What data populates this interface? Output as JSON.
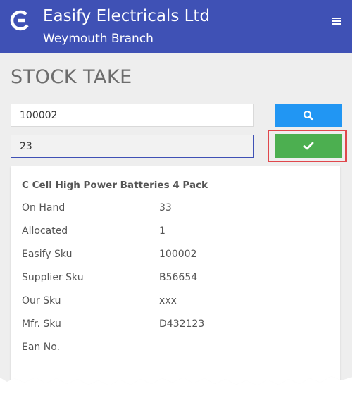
{
  "header": {
    "company": "Easify Electricals Ltd",
    "branch": "Weymouth Branch",
    "logo_icon": "easify-e-logo",
    "menu_icon": "hamburger-menu-icon",
    "background_color": "#3f51b5"
  },
  "page": {
    "title": "STOCK TAKE"
  },
  "form": {
    "sku_value": "100002",
    "quantity_value": "23",
    "search_button_icon": "search-icon",
    "search_button_color": "#2196f3",
    "confirm_button_icon": "check-icon",
    "confirm_button_color": "#4caf50",
    "highlight_color": "#e0474c"
  },
  "product": {
    "name": "C Cell High Power Batteries 4 Pack",
    "details": [
      {
        "label": "On Hand",
        "value": "33"
      },
      {
        "label": "Allocated",
        "value": "1"
      },
      {
        "label": "Easify Sku",
        "value": "100002"
      },
      {
        "label": "Supplier Sku",
        "value": "B56654"
      },
      {
        "label": "Our Sku",
        "value": "xxx"
      },
      {
        "label": "Mfr. Sku",
        "value": "D432123"
      },
      {
        "label": "Ean No.",
        "value": ""
      }
    ]
  }
}
